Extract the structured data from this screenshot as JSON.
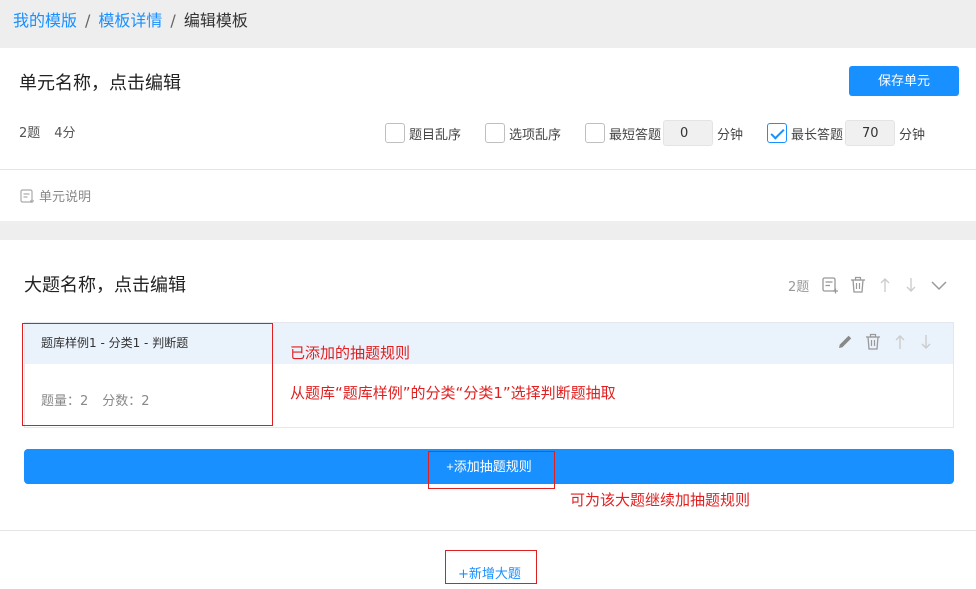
{
  "breadcrumb": {
    "items": [
      "我的模版",
      "模板详情",
      "编辑模板"
    ],
    "separator": "/"
  },
  "unit": {
    "title": "单元名称，点击编辑",
    "save_label": "保存单元",
    "question_count": "2题",
    "score": "4分",
    "options": {
      "shuffle_questions": {
        "label": "题目乱序",
        "checked": false
      },
      "shuffle_options": {
        "label": "选项乱序",
        "checked": false
      },
      "min_time": {
        "label": "最短答题",
        "checked": false,
        "value": "0",
        "unit": "分钟"
      },
      "max_time": {
        "label": "最长答题",
        "checked": true,
        "value": "70",
        "unit": "分钟"
      }
    },
    "description_label": "单元说明"
  },
  "question": {
    "title": "大题名称，点击编辑",
    "count": "2题",
    "icons": [
      "add-note-icon",
      "trash-icon",
      "arrow-up-icon",
      "arrow-down-icon",
      "chevron-down-icon"
    ],
    "rule": {
      "name": "题库样例1 - 分类1 - 判断题",
      "count_text": "题量：2",
      "score_text": "分数：2",
      "icons": [
        "edit-pencil-icon",
        "trash-icon",
        "arrow-up-icon",
        "arrow-down-icon"
      ]
    },
    "add_rule_label": "+添加抽题规则"
  },
  "new_question_label": "+新增大题",
  "annotations": {
    "added_rule": "已添加的抽题规则",
    "rule_desc": "从题库“题库样例”的分类“分类1”选择判断题抽取",
    "add_more": "可为该大题继续加抽题规则"
  },
  "colors": {
    "primary": "#1890ff",
    "annotation": "#e02020",
    "band": "#eeeeee",
    "rule_header": "#eaf2fc"
  }
}
